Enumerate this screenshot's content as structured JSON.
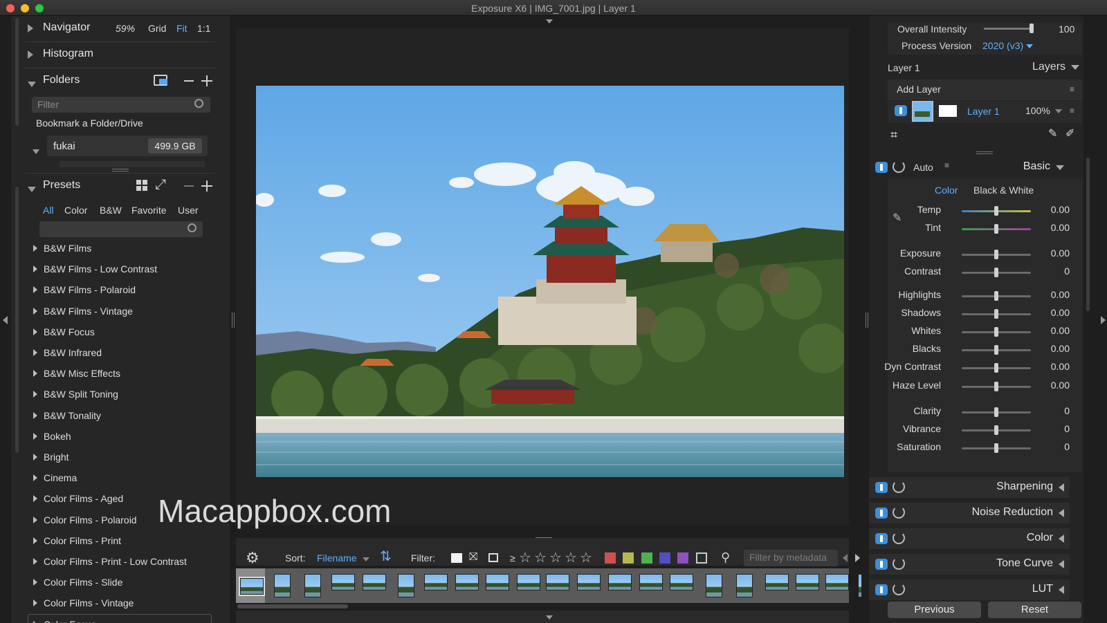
{
  "window": {
    "title": "Exposure X6 | IMG_7001.jpg | Layer 1"
  },
  "navigator": {
    "title": "Navigator",
    "zoom": "59%",
    "grid": "Grid",
    "fit": "Fit",
    "one": "1:1"
  },
  "histogram": {
    "title": "Histogram"
  },
  "folders": {
    "title": "Folders",
    "filter_placeholder": "Filter",
    "bookmark": "Bookmark a Folder/Drive",
    "drive_name": "fukai",
    "drive_size": "499.9 GB"
  },
  "presets": {
    "title": "Presets",
    "tabs": [
      "All",
      "Color",
      "B&W",
      "Favorite",
      "User"
    ],
    "items": [
      "B&W Films",
      "B&W Films - Low Contrast",
      "B&W Films - Polaroid",
      "B&W Films - Vintage",
      "B&W Focus",
      "B&W Infrared",
      "B&W Misc Effects",
      "B&W Split Toning",
      "B&W Tonality",
      "Bokeh",
      "Bright",
      "Cinema",
      "Color Films - Aged",
      "Color Films - Polaroid",
      "Color Films - Print",
      "Color Films - Print - Low Contrast",
      "Color Films - Slide",
      "Color Films - Vintage",
      "Color Focus"
    ]
  },
  "watermark": "Macappbox.com",
  "toolbar": {
    "sort_label": "Sort:",
    "sort_value": "Filename",
    "filter_label": "Filter:",
    "ge": "≥",
    "metadata_placeholder": "Filter by metadata",
    "swatches": [
      "#d05050",
      "#b8b850",
      "#50b050",
      "#5050c0",
      "#9050c0"
    ]
  },
  "right": {
    "overall_intensity": {
      "label": "Overall Intensity",
      "value": "100"
    },
    "process_version": {
      "label": "Process Version",
      "value": "2020 (v3)"
    },
    "layer_name": "Layer 1",
    "layers_label": "Layers",
    "add_layer": "Add Layer",
    "layer_item": "Layer 1",
    "layer_opacity": "100%",
    "basic": {
      "auto": "Auto",
      "title": "Basic",
      "color_tab": "Color",
      "bw_tab": "Black & White",
      "sliders": [
        {
          "label": "Temp",
          "value": "0.00"
        },
        {
          "label": "Tint",
          "value": "0.00"
        },
        {
          "label": "Exposure",
          "value": "0.00"
        },
        {
          "label": "Contrast",
          "value": "0"
        },
        {
          "label": "Highlights",
          "value": "0.00"
        },
        {
          "label": "Shadows",
          "value": "0.00"
        },
        {
          "label": "Whites",
          "value": "0.00"
        },
        {
          "label": "Blacks",
          "value": "0.00"
        },
        {
          "label": "Dyn Contrast",
          "value": "0.00"
        },
        {
          "label": "Haze Level",
          "value": "0.00"
        },
        {
          "label": "Clarity",
          "value": "0"
        },
        {
          "label": "Vibrance",
          "value": "0"
        },
        {
          "label": "Saturation",
          "value": "0"
        }
      ]
    },
    "sections": [
      "Sharpening",
      "Noise Reduction",
      "Color",
      "Tone Curve",
      "LUT"
    ],
    "previous": "Previous",
    "reset": "Reset"
  }
}
